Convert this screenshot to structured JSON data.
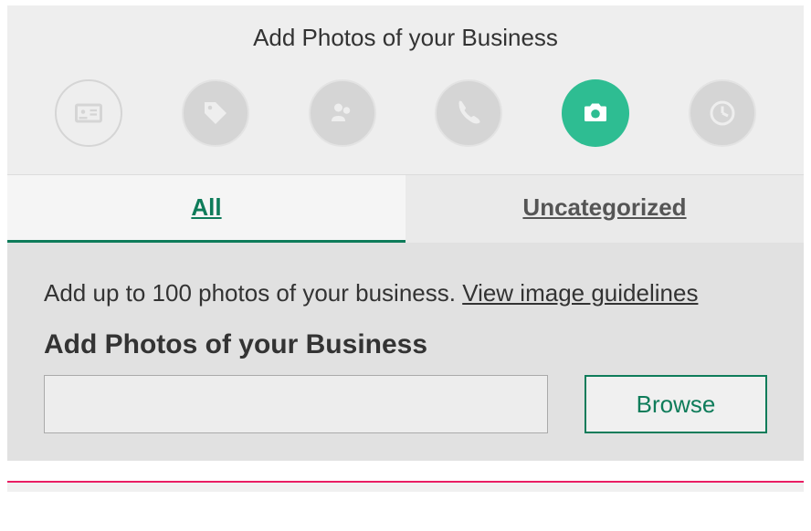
{
  "header": {
    "title": "Add Photos of your Business"
  },
  "steps": [
    {
      "name": "business-info",
      "active": false,
      "style": "outline"
    },
    {
      "name": "tags",
      "active": false,
      "style": "filled"
    },
    {
      "name": "people",
      "active": false,
      "style": "filled"
    },
    {
      "name": "phone",
      "active": false,
      "style": "filled"
    },
    {
      "name": "photos",
      "active": true,
      "style": "active"
    },
    {
      "name": "hours",
      "active": false,
      "style": "filled"
    }
  ],
  "tabs": {
    "all": {
      "label": "All",
      "active": true
    },
    "uncategorized": {
      "label": "Uncategorized",
      "active": false
    }
  },
  "content": {
    "info_prefix": "Add up to 100 photos of your business. ",
    "guidelines_link": "View image guidelines",
    "section_heading": "Add Photos of your Business",
    "browse_label": "Browse"
  },
  "colors": {
    "accent": "#2ebd92",
    "accent_dark": "#0e7c5a"
  }
}
